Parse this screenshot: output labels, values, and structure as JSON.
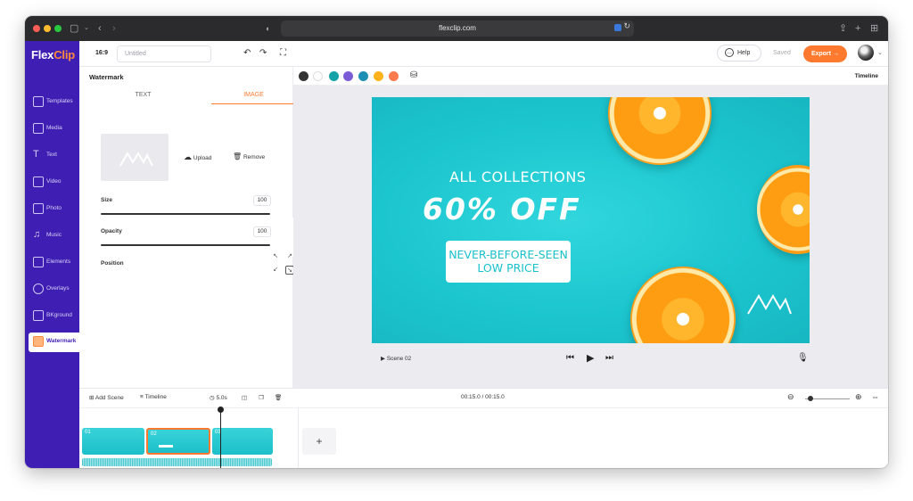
{
  "browser": {
    "url": "flexclip.com"
  },
  "app": {
    "logo_flex": "Flex",
    "logo_clip": "Clip"
  },
  "sidebar": {
    "items": [
      {
        "label": "Templates",
        "icon": "templates-icon"
      },
      {
        "label": "Media",
        "icon": "media-icon"
      },
      {
        "label": "Text",
        "icon": "text-icon"
      },
      {
        "label": "Video",
        "icon": "video-icon"
      },
      {
        "label": "Photo",
        "icon": "photo-icon"
      },
      {
        "label": "Music",
        "icon": "music-icon"
      },
      {
        "label": "Elements",
        "icon": "elements-icon"
      },
      {
        "label": "Overlays",
        "icon": "overlays-icon"
      },
      {
        "label": "BKground",
        "icon": "background-icon"
      },
      {
        "label": "Watermark",
        "icon": "watermark-icon",
        "active": true
      }
    ]
  },
  "toolbar": {
    "ratio": "16:9",
    "title_placeholder": "Untitled",
    "help_label": "Help",
    "saved_label": "Saved",
    "export_label": "Export →"
  },
  "panel": {
    "title": "Watermark",
    "tabs": [
      {
        "label": "TEXT"
      },
      {
        "label": "IMAGE",
        "active": true
      }
    ],
    "upload_label": "Upload",
    "remove_label": "Remove",
    "size_label": "Size",
    "size_value": "100",
    "opacity_label": "Opacity",
    "opacity_value": "100",
    "position_label": "Position",
    "position_selected": "bottom-right"
  },
  "colorbar": {
    "colors": [
      "#333333",
      "#ffffff",
      "#16a3a8",
      "#7b5cd6",
      "#1d8fb5",
      "#ffb21a",
      "#ff7a4d"
    ],
    "timeline_label": "Timeline"
  },
  "canvas": {
    "headline": "ALL COLLECTIONS",
    "offer": "60% OFF",
    "tag_line1": "NEVER-BEFORE-SEEN",
    "tag_line2": "LOW PRICE",
    "background": "#1ec9d1"
  },
  "preview": {
    "scene_label": "Scene  02"
  },
  "timeline": {
    "add_scene": "Add Scene",
    "timeline_label": "Timeline",
    "duration": "5.0s",
    "time": "00:15.0 / 00:15.0",
    "clips": [
      {
        "num": "01"
      },
      {
        "num": "02",
        "selected": true
      },
      {
        "num": "03"
      }
    ],
    "add_label": "+"
  },
  "accent": {
    "brand": "#3f1fb3",
    "orange": "#ff7a2e"
  }
}
